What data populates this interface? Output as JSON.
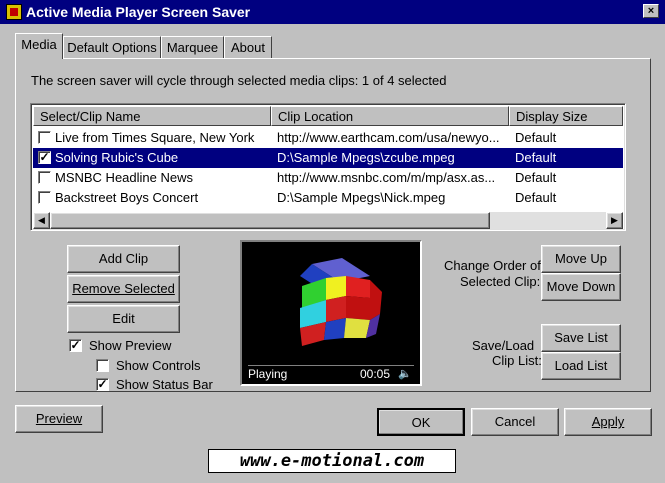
{
  "window": {
    "title": "Active Media Player Screen Saver",
    "close_glyph": "×"
  },
  "tabs": [
    {
      "label": "Media",
      "active": true
    },
    {
      "label": "Default Options",
      "active": false
    },
    {
      "label": "Marquee",
      "active": false
    },
    {
      "label": "About",
      "active": false
    }
  ],
  "media": {
    "summary": "The screen saver will cycle through selected media clips:  1 of 4 selected",
    "columns": [
      "Select/Clip Name",
      "Clip Location",
      "Display Size"
    ],
    "clips": [
      {
        "checked": false,
        "selected": false,
        "name": "Live from Times Square, New York",
        "location": "http://www.earthcam.com/usa/newyo...",
        "size": "Default"
      },
      {
        "checked": true,
        "selected": true,
        "name": "Solving Rubic's Cube",
        "location": "D:\\Sample Mpegs\\zcube.mpeg",
        "size": "Default"
      },
      {
        "checked": false,
        "selected": false,
        "name": "MSNBC Headline News",
        "location": "http://www.msnbc.com/m/mp/asx.as...",
        "size": "Default"
      },
      {
        "checked": false,
        "selected": false,
        "name": "Backstreet Boys Concert",
        "location": "D:\\Sample Mpegs\\Nick.mpeg",
        "size": "Default"
      }
    ],
    "add_clip": "Add Clip",
    "remove_selected": "Remove Selected",
    "edit": "Edit",
    "show_preview": {
      "label": "Show Preview",
      "checked": true
    },
    "show_controls": {
      "label": "Show Controls",
      "checked": false
    },
    "show_status_bar": {
      "label": "Show Status Bar",
      "checked": true
    },
    "preview_status": {
      "state": "Playing",
      "time": "00:05"
    },
    "change_order_label_1": "Change Order of",
    "change_order_label_2": "Selected Clip:",
    "move_up": "Move Up",
    "move_down": "Move Down",
    "saveload_label_1": "Save/Load",
    "saveload_label_2": "Clip List:",
    "save_list": "Save List",
    "load_list": "Load List"
  },
  "footer": {
    "preview": "Preview",
    "ok": "OK",
    "cancel": "Cancel",
    "apply": "Apply",
    "website": "www.e-motional.com"
  },
  "colors": {
    "selection": "#000080",
    "face": "#c0c0c0",
    "titlebar": "#000080"
  }
}
